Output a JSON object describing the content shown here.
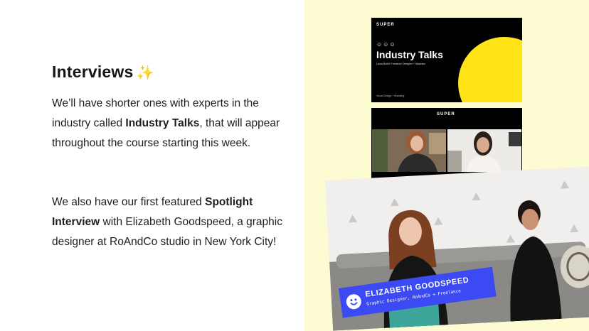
{
  "heading": {
    "text": "Interviews",
    "emoji": "✨"
  },
  "paragraph1": {
    "before": "We’ll have shorter ones with experts in the industry called ",
    "bold": "Industry Talks",
    "after": ", that will appear throughout the course starting this week."
  },
  "paragraph2": {
    "before": "We also have our first featured ",
    "bold": "Spotlight Interview",
    "after": " with Elizabeth Goodspeed, a graphic designer at RoAndCo studio in New York City!"
  },
  "slide1": {
    "logo": "SUPER",
    "smileys": "☺☺☺",
    "title": "Industry Talks",
    "subtitle": "Laura Bottili: Freelance Designer + Illustrator",
    "footer": "Visual Design + Branding"
  },
  "slide2": {
    "logo": "SUPER"
  },
  "nameplate": {
    "name": "ELIZABETH GOODSPEED",
    "role": "Graphic Designer, RoAndCo + Freelance"
  },
  "colors": {
    "yellow_bg": "#fdfbd1",
    "accent_yellow": "#ffe317",
    "nameplate_blue": "#3b4af2"
  }
}
